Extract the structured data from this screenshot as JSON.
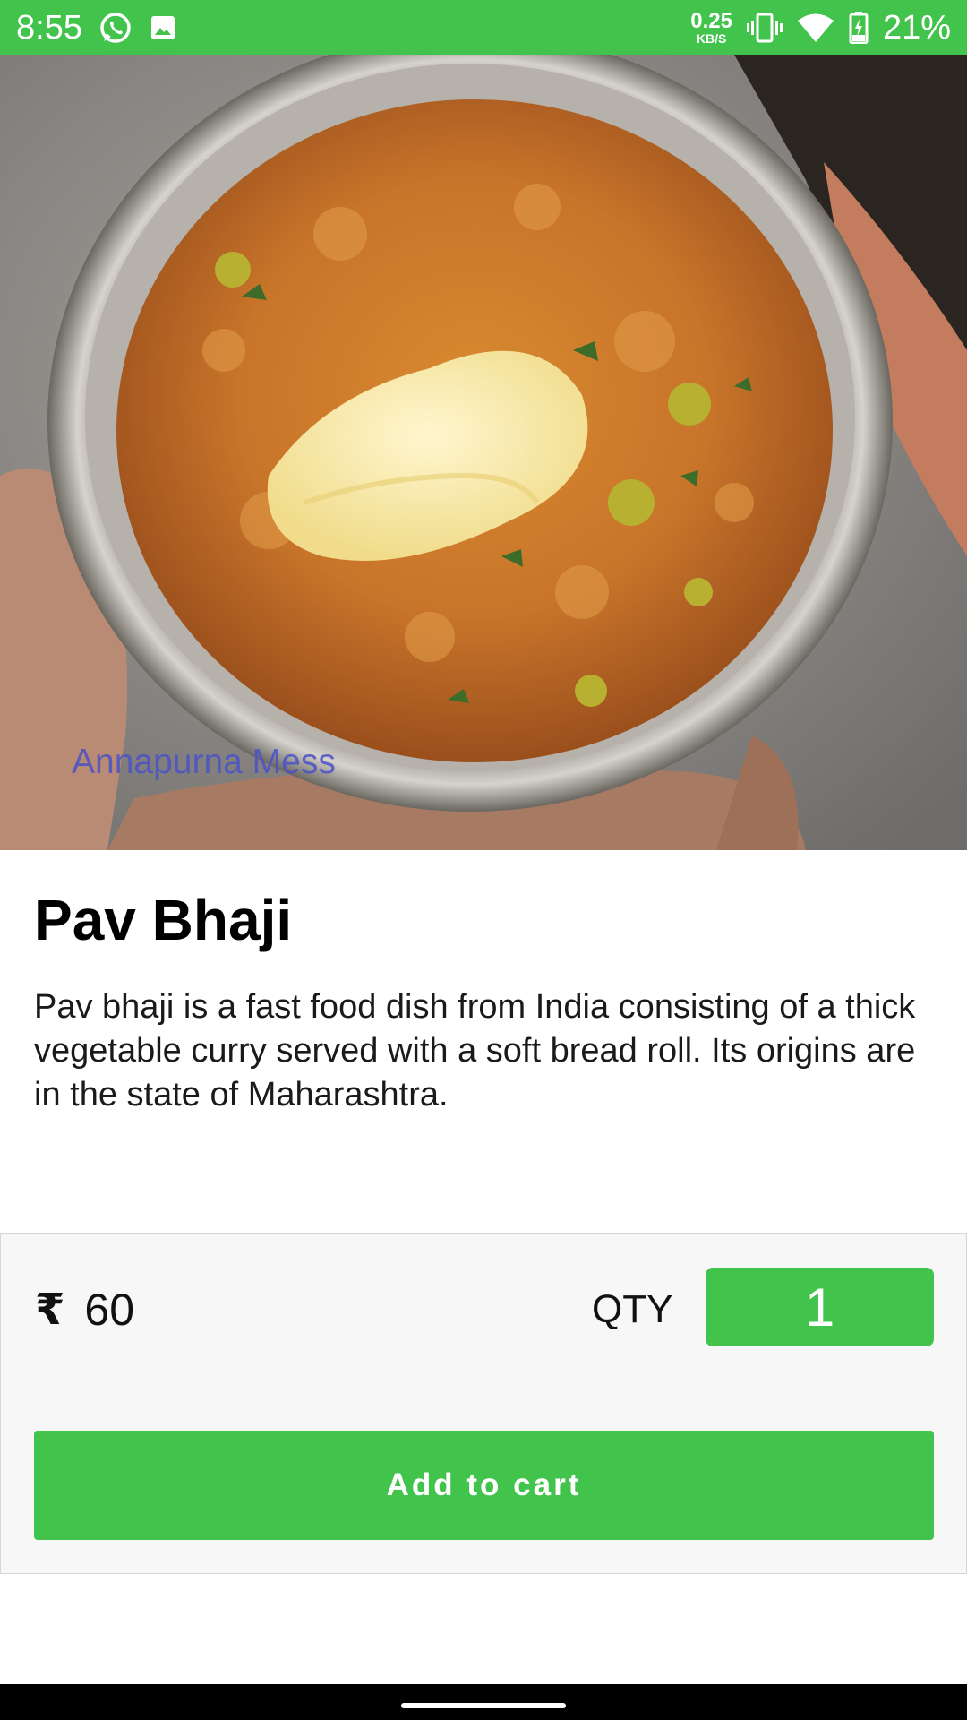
{
  "status_bar": {
    "time": "8:55",
    "net_speed_value": "0.25",
    "net_speed_unit": "KB/S",
    "battery_percent": "21%",
    "icons": [
      "whatsapp-icon",
      "image-icon",
      "vibrate-icon",
      "wifi-icon",
      "battery-charging-icon"
    ]
  },
  "hero": {
    "image": "pav-bhaji-bowl-photo",
    "watermark": "Annapurna Mess"
  },
  "item": {
    "title": "Pav Bhaji",
    "description": "Pav bhaji is a fast food dish from India consisting of a thick vegetable curry served with a soft bread roll. Its origins are in the state of Maharashtra."
  },
  "order": {
    "currency_symbol": "₹",
    "price": "60",
    "qty_label": "QTY",
    "qty_value": "1",
    "add_to_cart_label": "Add to cart"
  },
  "colors": {
    "accent": "#42c44c",
    "watermark": "#4a52c8"
  }
}
